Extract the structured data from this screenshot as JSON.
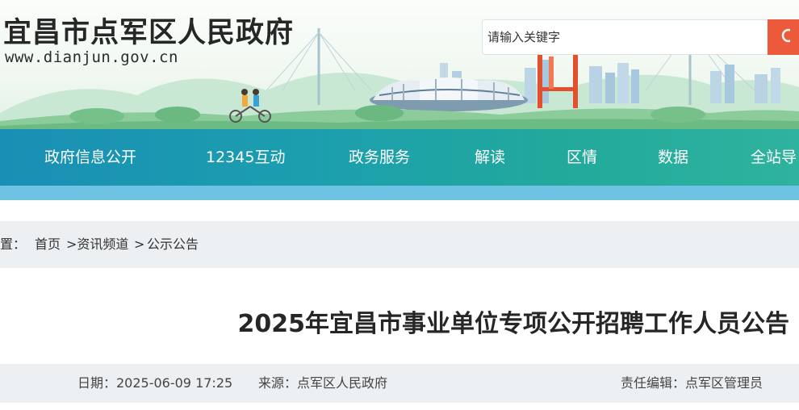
{
  "header": {
    "site_title": "宜昌市点军区人民政府",
    "site_url": "www.dianjun.gov.cn"
  },
  "search": {
    "placeholder": "请输入关键字",
    "button_icon": "search-icon",
    "button_color": "#ec5a3b"
  },
  "nav": {
    "items": [
      "政府信息公开",
      "12345互动",
      "政务服务",
      "解读",
      "区情",
      "数据",
      "全站导"
    ]
  },
  "breadcrumb": {
    "prefix": "位置：",
    "items": [
      "首页",
      ">资讯频道",
      ">",
      "公示公告"
    ]
  },
  "article": {
    "title": "2025年宜昌市事业单位专项公开招聘工作人员公告",
    "date": "日期：2025-06-09 17:25",
    "source": "来源：点军区人民政府",
    "editor": "责任编辑：点军区管理员"
  },
  "colors": {
    "nav_start": "#1a8fb5",
    "nav_end": "#2fb39f",
    "accent": "#ec5a3b"
  }
}
